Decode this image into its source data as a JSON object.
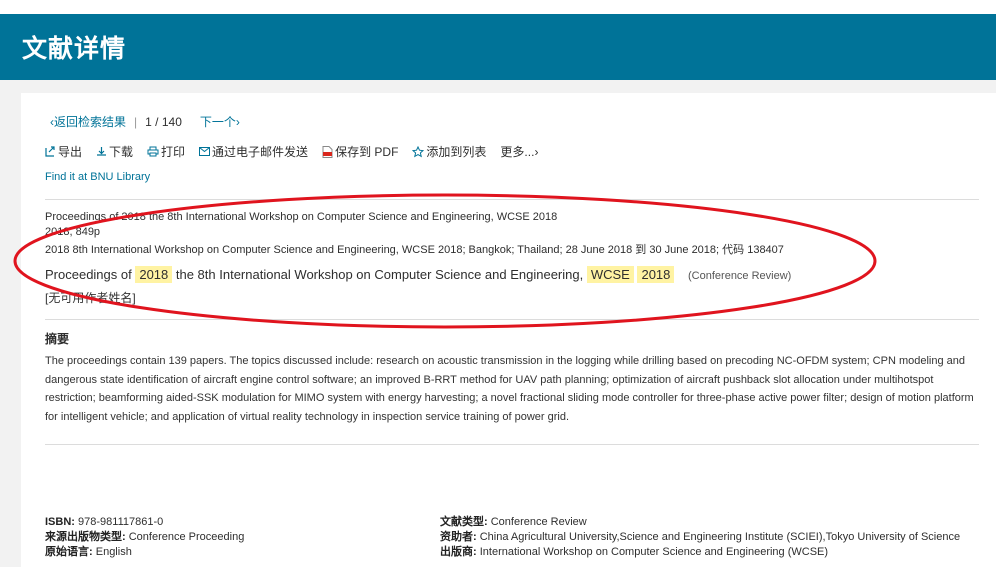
{
  "header": {
    "title": "文献详情"
  },
  "nav": {
    "back_label": "返回检索结果",
    "position": "1",
    "separator": "/",
    "total": "140",
    "next_label": "下一个"
  },
  "toolbar": {
    "export": "导出",
    "download": "下载",
    "print": "打印",
    "email": "通过电子邮件发送",
    "save_pdf": "保存到 PDF",
    "add_list": "添加到列表",
    "more": "更多..."
  },
  "library_link": "Find it at BNU Library",
  "source": {
    "line1": "Proceedings of 2018 the 8th International Workshop on Computer Science and Engineering, WCSE 2018",
    "line2": "2018, 849p",
    "line3": "2018 8th International Workshop on Computer Science and Engineering, WCSE 2018; Bangkok; Thailand; 28 June 2018 到 30 June 2018; 代码 138407"
  },
  "title": {
    "part1": "Proceedings of ",
    "hl1": "2018",
    "part2": " the 8th International Workshop on Computer Science and Engineering, ",
    "hl2": "WCSE",
    "hl3": "2018",
    "doc_type": "(Conference Review)"
  },
  "author": "[无可用作者姓名]",
  "abstract": {
    "heading": "摘要",
    "text": "The proceedings contain 139 papers. The topics discussed include: research on acoustic transmission in the logging while drilling based on precoding NC-OFDM system; CPN modeling and dangerous state identification of aircraft engine control software; an improved B-RRT method for UAV path planning; optimization of aircraft pushback slot allocation under multihotspot restriction; beamforming aided-SSK modulation for MIMO system with energy harvesting; a novel fractional sliding mode controller for three-phase active power filter; design of motion platform for intelligent vehicle; and application of virtual reality technology in inspection service training of power grid."
  },
  "meta_left": {
    "isbn_label": "ISBN:",
    "isbn_value": "978-981117861-0",
    "pubtype_label": "来源出版物类型:",
    "pubtype_value": "Conference Proceeding",
    "lang_label": "原始语言:",
    "lang_value": "English"
  },
  "meta_right": {
    "doctype_label": "文献类型:",
    "doctype_value": "Conference Review",
    "sponsor_label": "资助者:",
    "sponsor_value": "China Agricultural University,Science and Engineering Institute (SCIEI),Tokyo University of Science",
    "publisher_label": "出版商:",
    "publisher_value": "International Workshop on Computer Science and Engineering (WCSE)"
  },
  "colors": {
    "header_bg": "#007398",
    "link": "#007398",
    "highlight": "#fff3a3",
    "annotation_ellipse": "#e0141e"
  }
}
